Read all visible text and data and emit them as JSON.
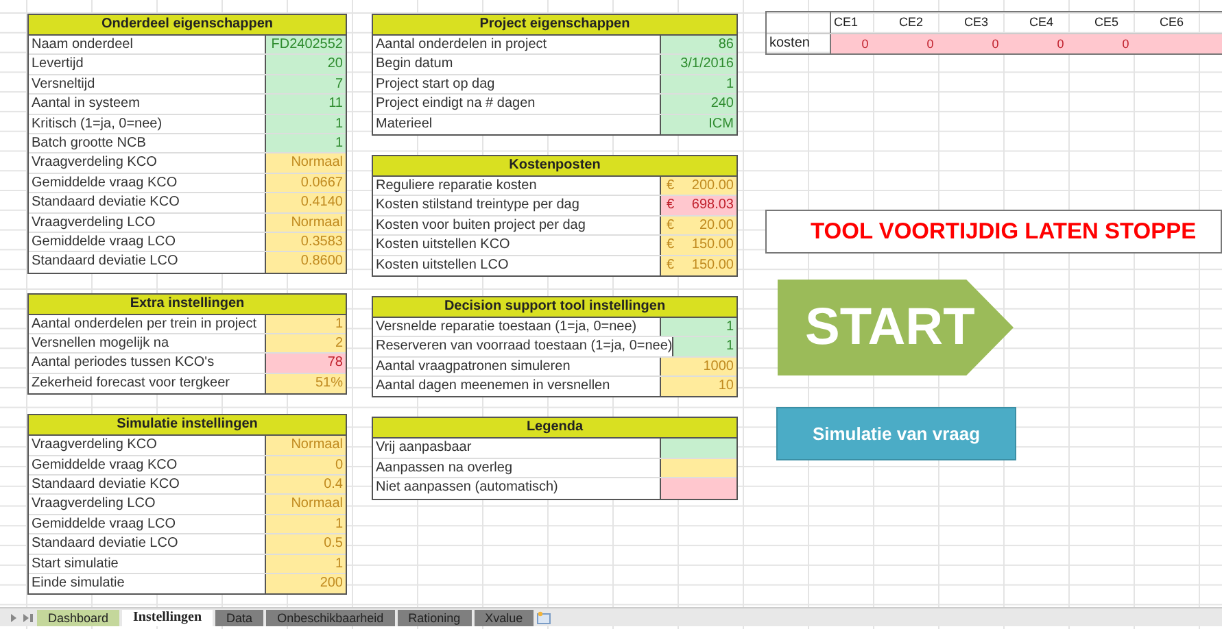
{
  "columns": [
    {
      "sections": [
        {
          "title": "Onderdeel eigenschappen",
          "rows": [
            {
              "label": "Naam onderdeel",
              "value": "FD2402552",
              "kind": "free"
            },
            {
              "label": "Levertijd",
              "value": "20",
              "kind": "free"
            },
            {
              "label": "Versneltijd",
              "value": "7",
              "kind": "free"
            },
            {
              "label": "Aantal in systeem",
              "value": "11",
              "kind": "free"
            },
            {
              "label": "Kritisch (1=ja, 0=nee)",
              "value": "1",
              "kind": "free"
            },
            {
              "label": "Batch grootte NCB",
              "value": "1",
              "kind": "free"
            },
            {
              "label": "Vraagverdeling KCO",
              "value": "Normaal",
              "kind": "consult"
            },
            {
              "label": "Gemiddelde vraag KCO",
              "value": "0.0667",
              "kind": "consult"
            },
            {
              "label": "Standaard deviatie KCO",
              "value": "0.4140",
              "kind": "consult"
            },
            {
              "label": "Vraagverdeling LCO",
              "value": "Normaal",
              "kind": "consult"
            },
            {
              "label": "Gemiddelde vraag LCO",
              "value": "0.3583",
              "kind": "consult"
            },
            {
              "label": "Standaard deviatie LCO",
              "value": "0.8600",
              "kind": "consult"
            }
          ]
        },
        {
          "title": "Extra instellingen",
          "rows": [
            {
              "label": "Aantal onderdelen per trein in project",
              "value": "1",
              "kind": "consult"
            },
            {
              "label": "Versnellen mogelijk na",
              "value": "2",
              "kind": "consult"
            },
            {
              "label": "Aantal periodes tussen KCO's",
              "value": "78",
              "kind": "auto"
            },
            {
              "label": "Zekerheid forecast voor tergkeer",
              "value": "51%",
              "kind": "consult"
            }
          ]
        },
        {
          "title": "Simulatie instellingen",
          "rows": [
            {
              "label": "Vraagverdeling KCO",
              "value": "Normaal",
              "kind": "consult"
            },
            {
              "label": "Gemiddelde vraag KCO",
              "value": "0",
              "kind": "consult"
            },
            {
              "label": "Standaard deviatie KCO",
              "value": "0.4",
              "kind": "consult"
            },
            {
              "label": "Vraagverdeling LCO",
              "value": "Normaal",
              "kind": "consult"
            },
            {
              "label": "Gemiddelde vraag LCO",
              "value": "1",
              "kind": "consult"
            },
            {
              "label": "Standaard deviatie LCO",
              "value": "0.5",
              "kind": "consult"
            },
            {
              "label": "Start simulatie",
              "value": "1",
              "kind": "consult"
            },
            {
              "label": "Einde simulatie",
              "value": "200",
              "kind": "consult"
            }
          ]
        }
      ]
    },
    {
      "sections": [
        {
          "title": "Project eigenschappen",
          "rows": [
            {
              "label": "Aantal onderdelen in project",
              "value": "86",
              "kind": "free"
            },
            {
              "label": "Begin datum",
              "value": "3/1/2016",
              "kind": "free"
            },
            {
              "label": "Project start op dag",
              "value": "1",
              "kind": "free"
            },
            {
              "label": "Project eindigt na # dagen",
              "value": "240",
              "kind": "free"
            },
            {
              "label": "Materieel",
              "value": "ICM",
              "kind": "free"
            }
          ]
        },
        {
          "title": "Kostenposten",
          "rows": [
            {
              "label": "Reguliere reparatie kosten",
              "currency": "€",
              "value": "200.00",
              "kind": "consult"
            },
            {
              "label": "Kosten stilstand treintype per dag",
              "currency": "€",
              "value": "698.03",
              "kind": "auto"
            },
            {
              "label": "Kosten voor buiten project per dag",
              "currency": "€",
              "value": "20.00",
              "kind": "consult"
            },
            {
              "label": "Kosten uitstellen KCO",
              "currency": "€",
              "value": "150.00",
              "kind": "consult"
            },
            {
              "label": "Kosten uitstellen LCO",
              "currency": "€",
              "value": "150.00",
              "kind": "consult"
            }
          ]
        },
        {
          "title": "Decision support tool instellingen",
          "rows": [
            {
              "label": "Versnelde reparatie toestaan (1=ja, 0=nee)",
              "value": "1",
              "kind": "free"
            },
            {
              "label": "Reserveren van voorraad toestaan (1=ja, 0=nee)",
              "value": "1",
              "kind": "free"
            },
            {
              "label": "Aantal vraagpatronen simuleren",
              "value": "1000",
              "kind": "consult"
            },
            {
              "label": "Aantal dagen meenemen in versnellen",
              "value": "10",
              "kind": "consult"
            }
          ]
        },
        {
          "title": "Legenda",
          "rows": [
            {
              "label": "Vrij aanpasbaar",
              "kind": "free"
            },
            {
              "label": "Aanpassen na overleg",
              "kind": "consult"
            },
            {
              "label": "Niet aanpassen (automatisch)",
              "kind": "auto"
            }
          ]
        }
      ]
    }
  ],
  "cost_table": {
    "row_label": "kosten",
    "columns": [
      "CE1",
      "CE2",
      "CE3",
      "CE4",
      "CE5",
      "CE6"
    ],
    "values": [
      "0",
      "0",
      "0",
      "0",
      "0"
    ]
  },
  "stop_banner": "TOOL VOORTIJDIG LATEN STOPPE",
  "start_button": "START",
  "simulation_button": "Simulatie van vraag",
  "sheet_tabs": [
    {
      "label": "Dashboard",
      "selected": false,
      "color": "#c4d79b"
    },
    {
      "label": "Instellingen",
      "selected": true,
      "color": "#ffffff"
    },
    {
      "label": "Data",
      "selected": false,
      "color": "#7f7f7f"
    },
    {
      "label": "Onbeschikbaarheid",
      "selected": false,
      "color": "#7f7f7f"
    },
    {
      "label": "Rationing",
      "selected": false,
      "color": "#7f7f7f"
    },
    {
      "label": "Xvalue",
      "selected": false,
      "color": "#7f7f7f"
    }
  ]
}
